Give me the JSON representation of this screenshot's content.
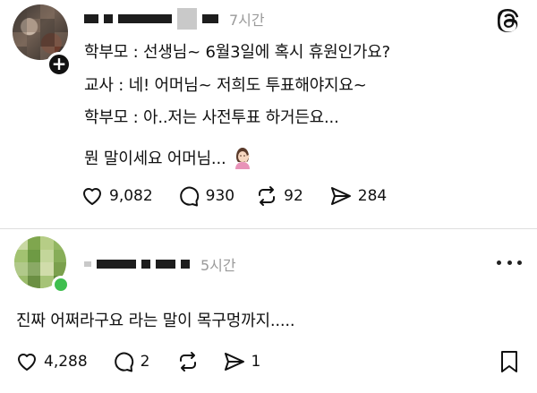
{
  "post": {
    "time": "7시간",
    "lines": [
      "학부모 : 선생님~ 6월3일에 혹시 휴원인가요?",
      "교사 : 네! 어머님~ 저희도 투표해야지요~",
      "학부모 : 아..저는 사전투표 하거든요...",
      "뭔 말이세요 어머님..."
    ],
    "emoji_icon": "facepalm-woman-emoji",
    "actions": {
      "likes": "9,082",
      "comments": "930",
      "reposts": "92",
      "shares": "284"
    }
  },
  "reply": {
    "time": "5시간",
    "text": "진짜 어쩌라구요 라는 말이 목구멍까지.....",
    "actions": {
      "likes": "4,288",
      "comments": "2",
      "shares": "1"
    }
  },
  "icons": {
    "brand": "threads-icon",
    "like": "heart-icon",
    "comment": "speech-bubble-icon",
    "repost": "repost-icon",
    "share": "send-icon",
    "more": "more-icon",
    "bookmark": "bookmark-icon"
  },
  "colors": {
    "text": "#111111",
    "muted": "#9a9a9a",
    "online": "#3fbf4f",
    "divider": "#dedede"
  }
}
